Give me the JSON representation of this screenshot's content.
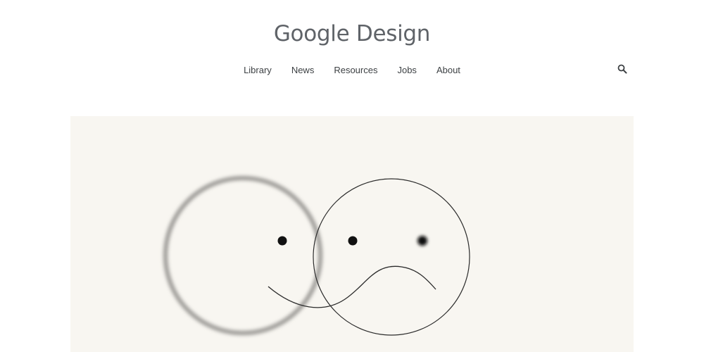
{
  "header": {
    "logo_brand": "Google",
    "logo_product": "Design"
  },
  "nav": {
    "items": [
      {
        "label": "Library"
      },
      {
        "label": "News"
      },
      {
        "label": "Resources"
      },
      {
        "label": "Jobs"
      },
      {
        "label": "About"
      }
    ]
  },
  "search": {
    "icon": "search-icon"
  },
  "hero": {
    "illustration": "two-overlapping-faces-happy-and-sad",
    "background_color": "#f8f6f1"
  }
}
